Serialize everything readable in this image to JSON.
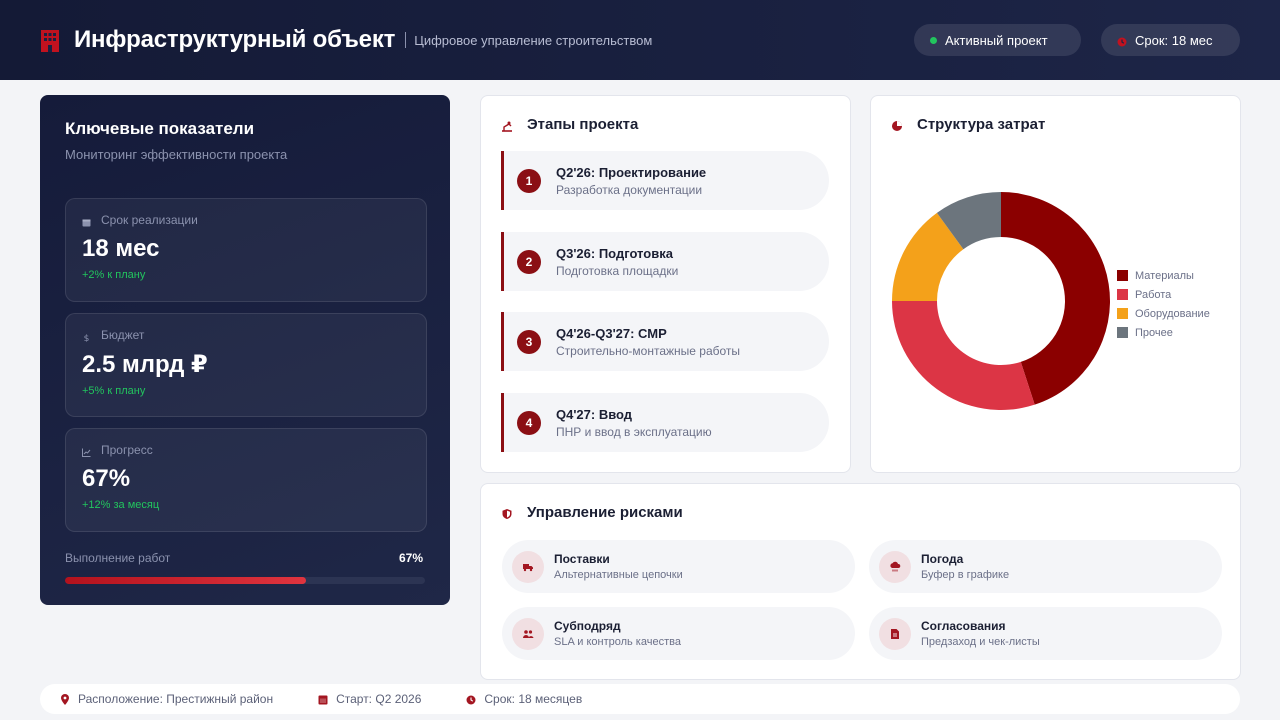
{
  "header": {
    "title": "Инфраструктурный объект",
    "subtitle": "Цифровое управление строительством",
    "logo_icon": "building-icon",
    "status_pill": "Активный проект",
    "term_pill": "Срок: 18 мес",
    "status_color": "#22c55e"
  },
  "kpi": {
    "title": "Ключевые показатели",
    "subtitle": "Мониторинг эффективности проекта",
    "cards": [
      {
        "label": "Срок реализации",
        "value": "18 мес",
        "delta": "+2% к плану",
        "icon": "calendar-icon"
      },
      {
        "label": "Бюджет",
        "value": "2.5 млрд ₽",
        "delta": "+5% к плану",
        "icon": "dollar-icon"
      },
      {
        "label": "Прогресс",
        "value": "67%",
        "delta": "+12% за месяц",
        "icon": "chart-icon"
      }
    ],
    "progress": {
      "label": "Выполнение работ",
      "value_text": "67%",
      "fraction": 0.67
    }
  },
  "stages": {
    "title": "Этапы проекта",
    "icon": "crane-icon",
    "items": [
      {
        "num": "1",
        "title": "Q2'26: Проектирование",
        "desc": "Разработка документации"
      },
      {
        "num": "2",
        "title": "Q3'26: Подготовка",
        "desc": "Подготовка площадки"
      },
      {
        "num": "3",
        "title": "Q4'26-Q3'27: СМР",
        "desc": "Строительно-монтажные работы"
      },
      {
        "num": "4",
        "title": "Q4'27: Ввод",
        "desc": "ПНР и ввод в эксплуатацию"
      }
    ]
  },
  "costs": {
    "title": "Структура затрат",
    "icon": "pie-chart-icon"
  },
  "chart_data": {
    "type": "pie",
    "categories": [
      "Материалы",
      "Работа",
      "Оборудование",
      "Прочее"
    ],
    "values": [
      45,
      30,
      15,
      10
    ],
    "colors": [
      "#8b0000",
      "#dc3545",
      "#f4a11a",
      "#6c757d"
    ],
    "donut": true,
    "legend": "right"
  },
  "risks": {
    "title": "Управление рисками",
    "icon": "shield-icon",
    "items": [
      {
        "title": "Поставки",
        "desc": "Альтернативные цепочки",
        "icon": "truck-icon"
      },
      {
        "title": "Погода",
        "desc": "Буфер в графике",
        "icon": "cloud-rain-icon"
      },
      {
        "title": "Субподряд",
        "desc": "SLA и контроль качества",
        "icon": "users-icon"
      },
      {
        "title": "Согласования",
        "desc": "Предзаход и чек-листы",
        "icon": "document-icon"
      }
    ]
  },
  "footer": {
    "location": "Расположение: Престижный район",
    "start": "Старт: Q2 2026",
    "duration": "Срок: 18 месяцев"
  }
}
